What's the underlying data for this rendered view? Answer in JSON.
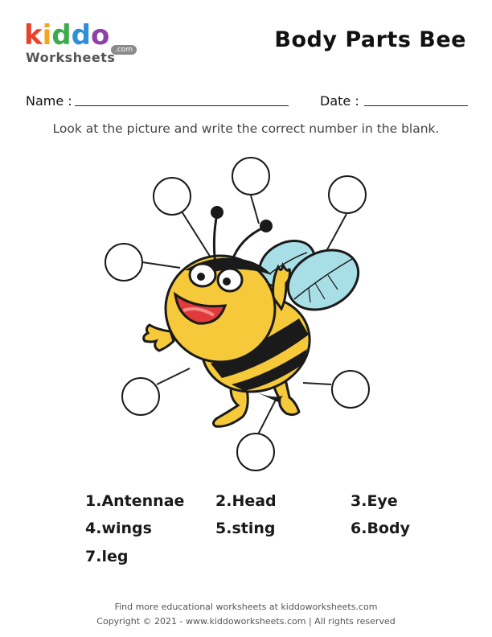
{
  "logo": {
    "letters": [
      {
        "char": "k",
        "color": "#e8412c"
      },
      {
        "char": "i",
        "color": "#f4a51c"
      },
      {
        "char": "d",
        "color": "#3daa4c"
      },
      {
        "char": "d",
        "color": "#2f8fd6"
      },
      {
        "char": "o",
        "color": "#8e3fa8"
      }
    ],
    "sub": "Worksheets",
    "com": ".com"
  },
  "title": "Body Parts Bee",
  "fields": {
    "name_label": "Name :",
    "date_label": "Date :"
  },
  "instruction": "Look at the picture and write the correct number in the blank.",
  "word_bank": [
    "1.Antennae",
    "2.Head",
    "3.Eye",
    "4.wings",
    "5.sting",
    "6.Body",
    "7.leg"
  ],
  "footer": {
    "line1": "Find more educational worksheets at kiddoworksheets.com",
    "line2": "Copyright © 2021 - www.kiddoworksheets.com  |  All rights reserved"
  },
  "colors": {
    "bee_yellow": "#f6c93a",
    "bee_black": "#1a1a1a",
    "wing_blue": "#a8dfe6",
    "mouth_red": "#e03a3a"
  }
}
